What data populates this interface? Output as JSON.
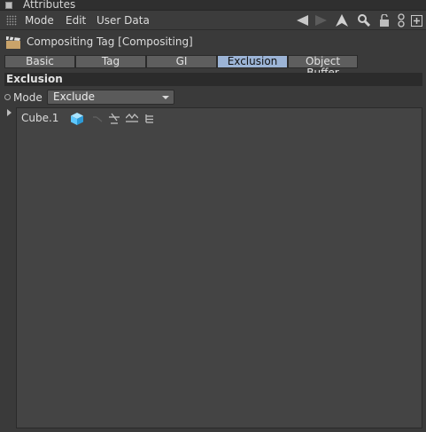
{
  "window": {
    "title": "Attributes"
  },
  "menubar": {
    "items": [
      "Mode",
      "Edit",
      "User Data"
    ]
  },
  "toolbar_icons": [
    "arrow-left-icon",
    "arrow-right-icon",
    "arrow-up-icon",
    "search-icon",
    "lock-icon",
    "link-icon",
    "new-window-icon"
  ],
  "tag": {
    "name": "Compositing Tag [Compositing]"
  },
  "tabs": [
    {
      "label": "Basic",
      "active": false
    },
    {
      "label": "Tag",
      "active": false
    },
    {
      "label": "GI",
      "active": false
    },
    {
      "label": "Exclusion",
      "active": true
    },
    {
      "label": "Object Buffer",
      "active": false
    }
  ],
  "section": {
    "title": "Exclusion"
  },
  "mode": {
    "label": "Mode",
    "value": "Exclude"
  },
  "list": {
    "items": [
      {
        "name": "Cube.1",
        "icons": [
          "cube-icon",
          "hierarchy-off-icon",
          "shadow-icon",
          "lighting-icon",
          "children-icon"
        ]
      }
    ]
  },
  "colors": {
    "accent": "#9cb4d6",
    "background": "#3a3a3a",
    "list_bg": "#444444",
    "cube": "#5ec8ff"
  }
}
